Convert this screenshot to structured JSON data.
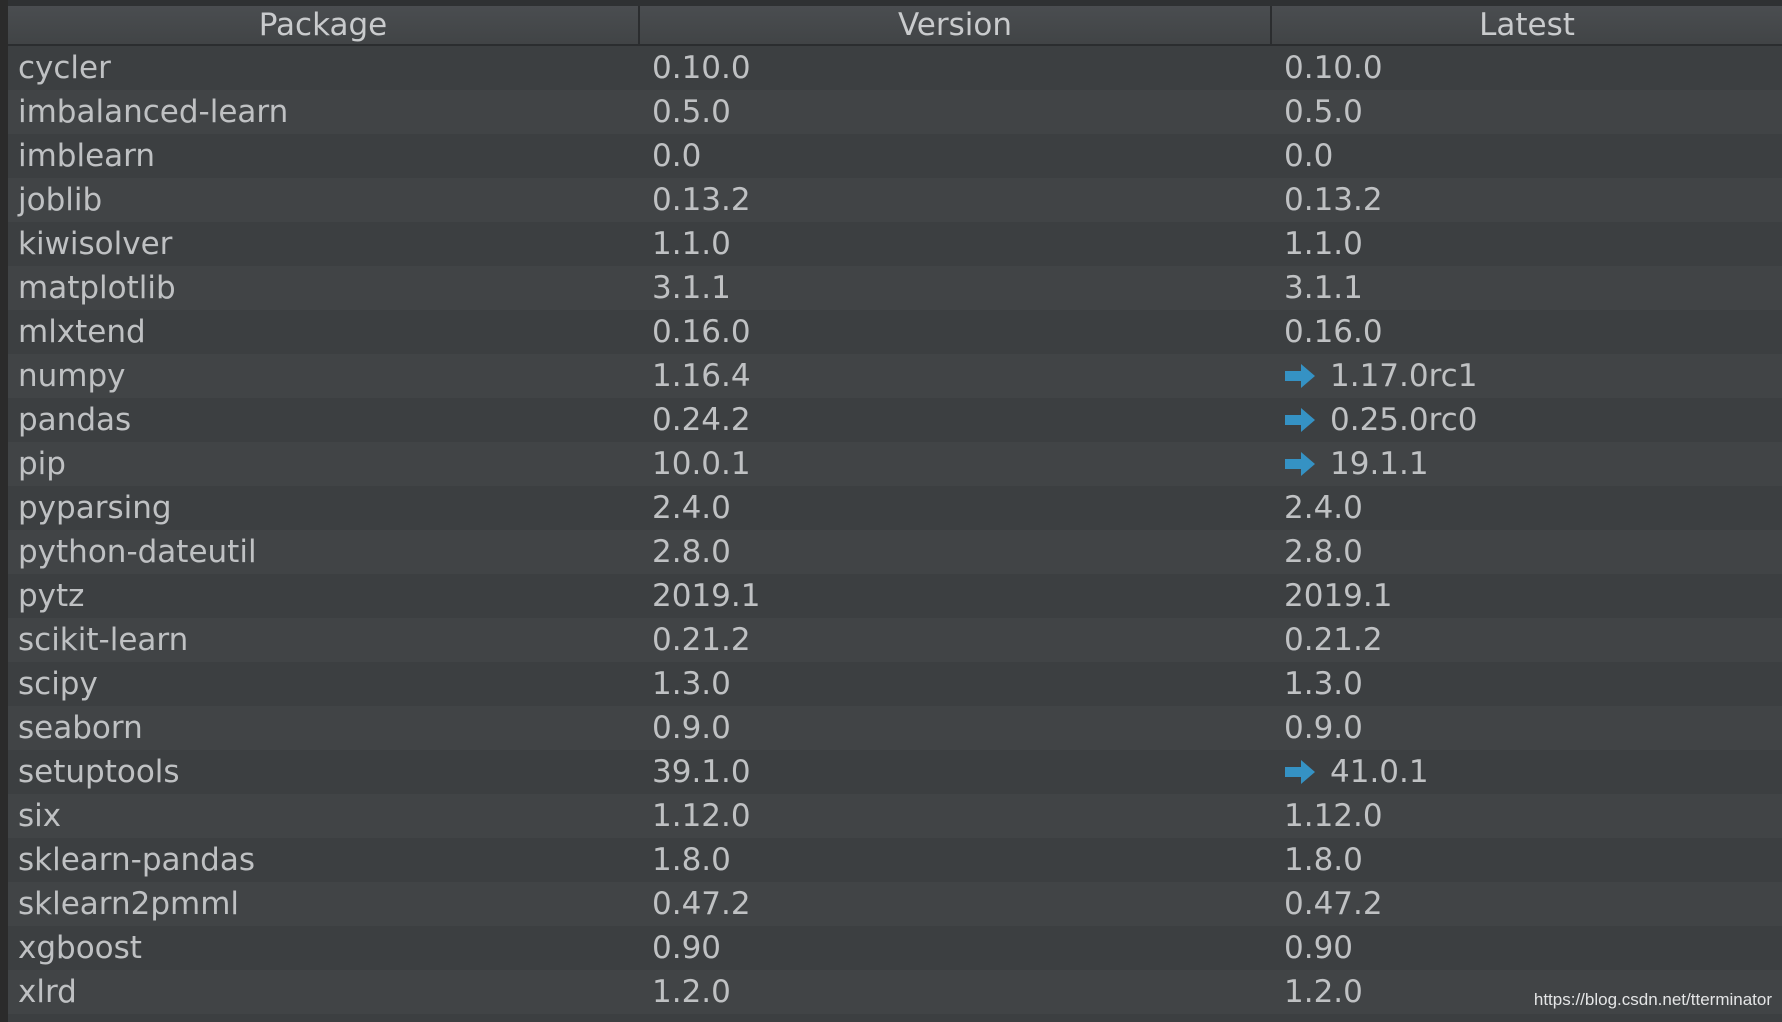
{
  "table": {
    "columns": [
      "Package",
      "Version",
      "Latest"
    ],
    "rows": [
      {
        "package": "cycler",
        "version": "0.10.0",
        "latest": "0.10.0",
        "upgrade": false
      },
      {
        "package": "imbalanced-learn",
        "version": "0.5.0",
        "latest": "0.5.0",
        "upgrade": false
      },
      {
        "package": "imblearn",
        "version": "0.0",
        "latest": "0.0",
        "upgrade": false
      },
      {
        "package": "joblib",
        "version": "0.13.2",
        "latest": "0.13.2",
        "upgrade": false
      },
      {
        "package": "kiwisolver",
        "version": "1.1.0",
        "latest": "1.1.0",
        "upgrade": false
      },
      {
        "package": "matplotlib",
        "version": "3.1.1",
        "latest": "3.1.1",
        "upgrade": false
      },
      {
        "package": "mlxtend",
        "version": "0.16.0",
        "latest": "0.16.0",
        "upgrade": false
      },
      {
        "package": "numpy",
        "version": "1.16.4",
        "latest": "1.17.0rc1",
        "upgrade": true
      },
      {
        "package": "pandas",
        "version": "0.24.2",
        "latest": "0.25.0rc0",
        "upgrade": true
      },
      {
        "package": "pip",
        "version": "10.0.1",
        "latest": "19.1.1",
        "upgrade": true
      },
      {
        "package": "pyparsing",
        "version": "2.4.0",
        "latest": "2.4.0",
        "upgrade": false
      },
      {
        "package": "python-dateutil",
        "version": "2.8.0",
        "latest": "2.8.0",
        "upgrade": false
      },
      {
        "package": "pytz",
        "version": "2019.1",
        "latest": "2019.1",
        "upgrade": false
      },
      {
        "package": "scikit-learn",
        "version": "0.21.2",
        "latest": "0.21.2",
        "upgrade": false
      },
      {
        "package": "scipy",
        "version": "1.3.0",
        "latest": "1.3.0",
        "upgrade": false
      },
      {
        "package": "seaborn",
        "version": "0.9.0",
        "latest": "0.9.0",
        "upgrade": false
      },
      {
        "package": "setuptools",
        "version": "39.1.0",
        "latest": "41.0.1",
        "upgrade": true
      },
      {
        "package": "six",
        "version": "1.12.0",
        "latest": "1.12.0",
        "upgrade": false
      },
      {
        "package": "sklearn-pandas",
        "version": "1.8.0",
        "latest": "1.8.0",
        "upgrade": false
      },
      {
        "package": "sklearn2pmml",
        "version": "0.47.2",
        "latest": "0.47.2",
        "upgrade": false
      },
      {
        "package": "xgboost",
        "version": "0.90",
        "latest": "0.90",
        "upgrade": false
      },
      {
        "package": "xlrd",
        "version": "1.2.0",
        "latest": "1.2.0",
        "upgrade": false
      }
    ]
  },
  "icons": {
    "upgrade": "upgrade-arrow-icon"
  },
  "colors": {
    "upgrade_arrow": "#3592c4"
  },
  "watermark": "https://blog.csdn.net/tterminator"
}
